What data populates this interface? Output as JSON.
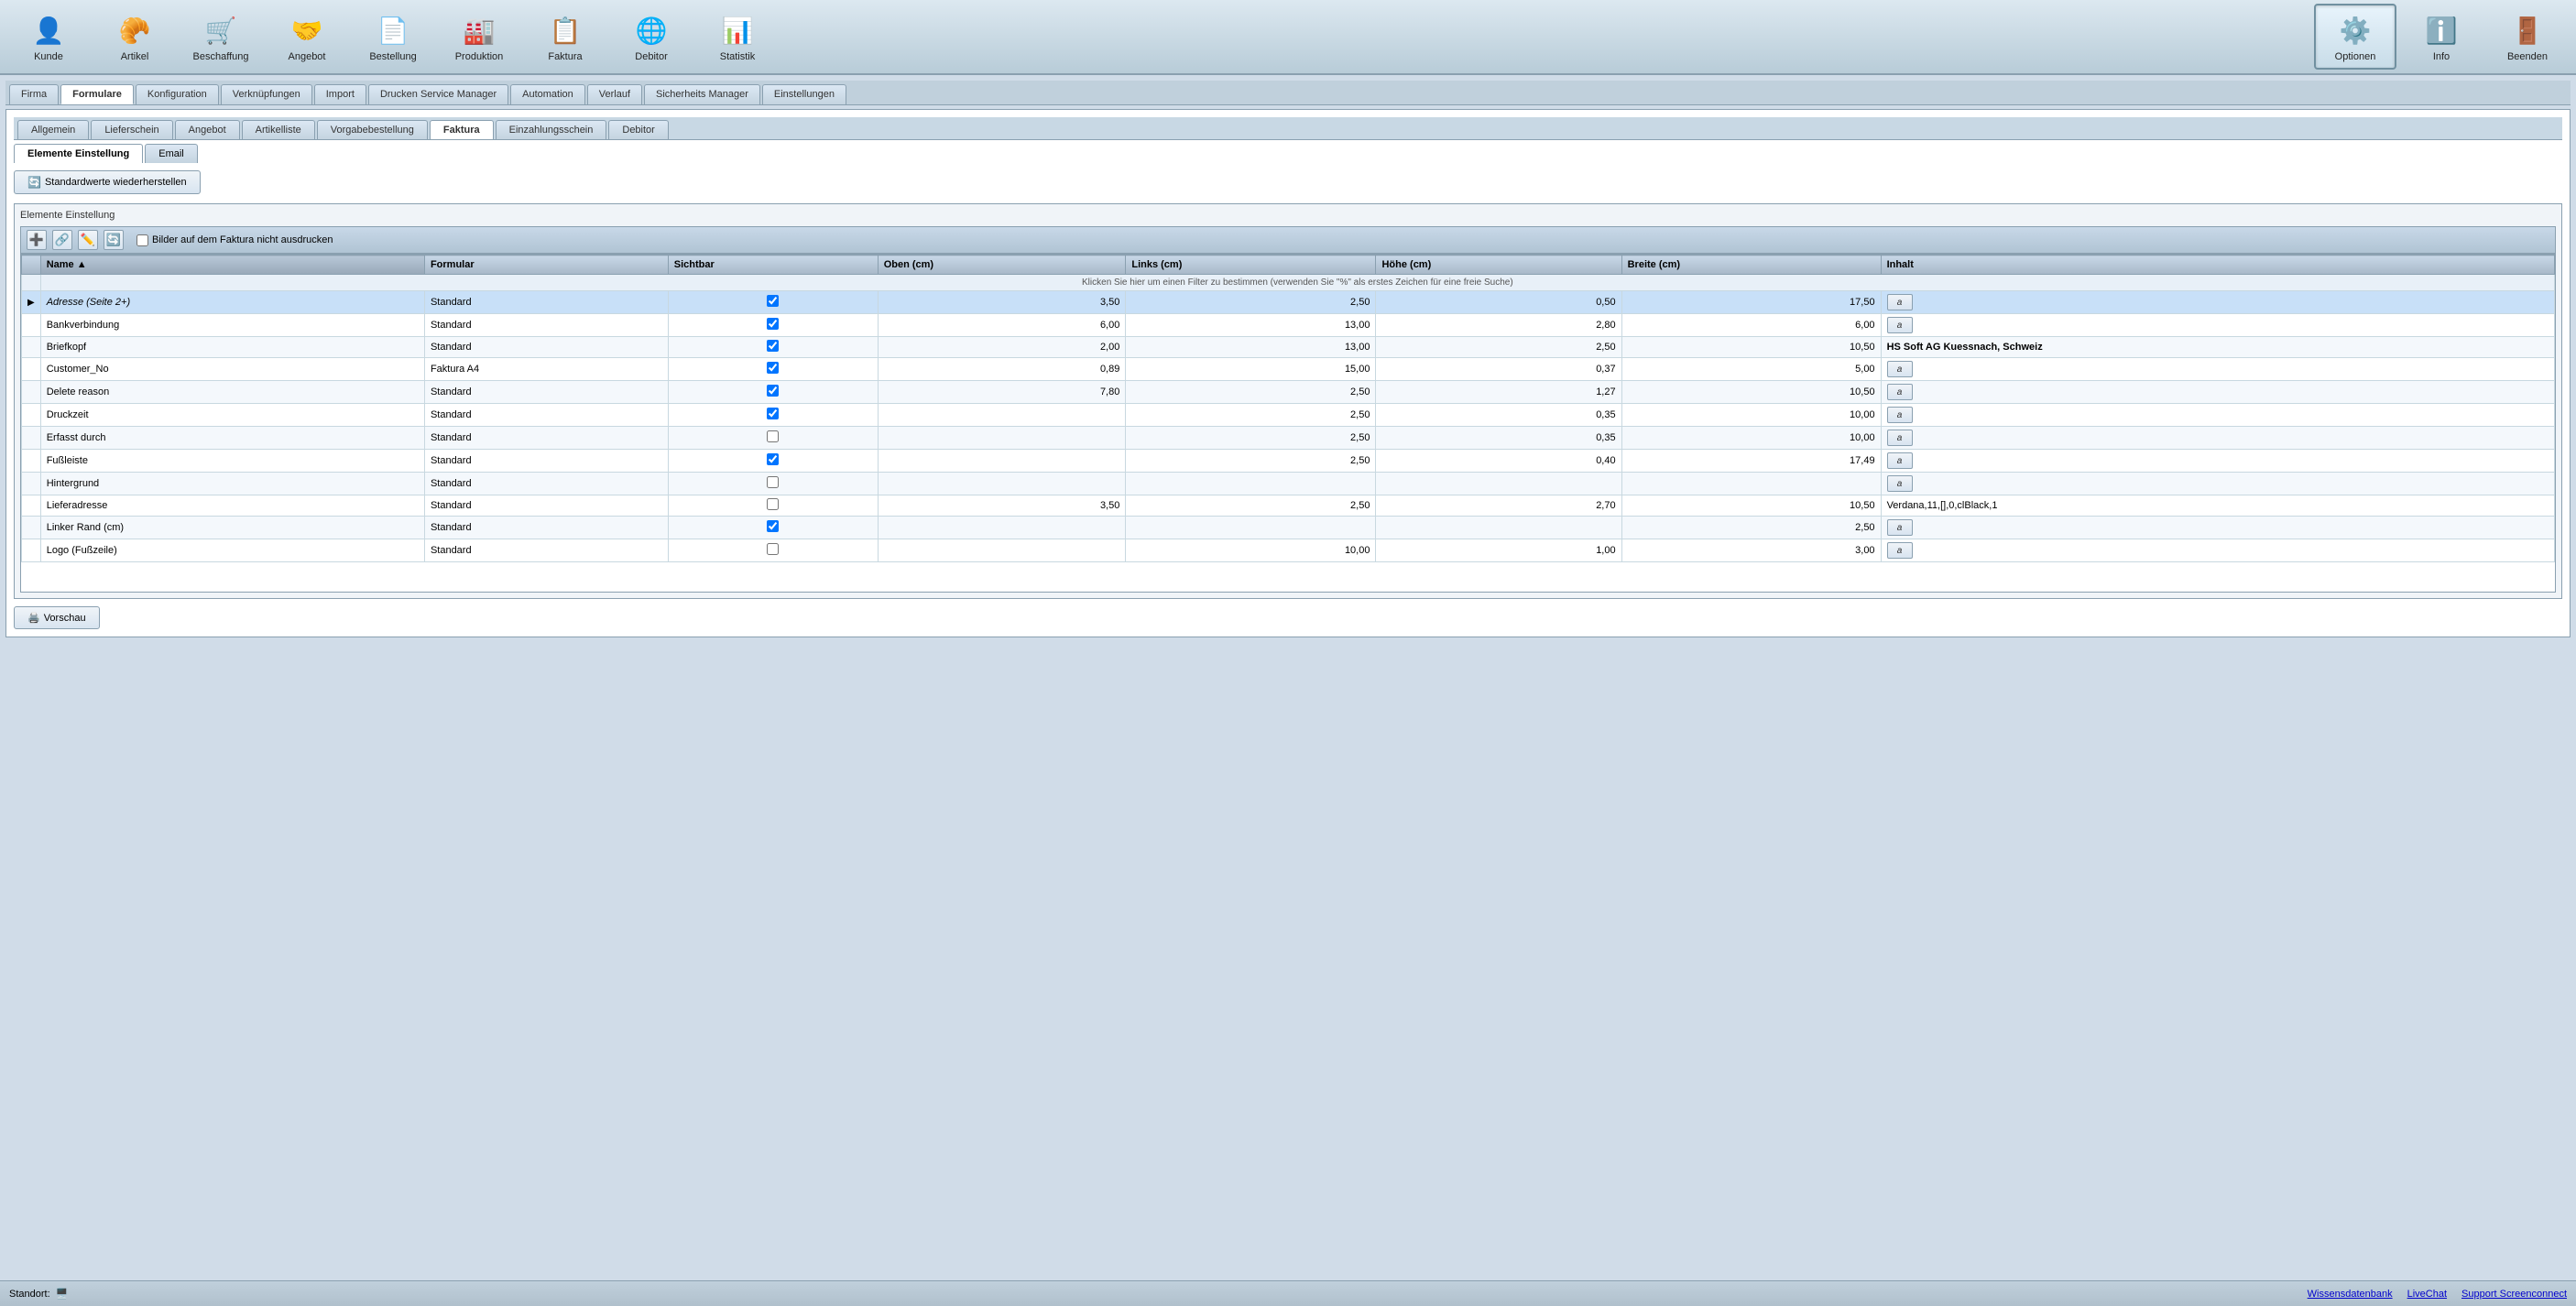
{
  "toolbar": {
    "items": [
      {
        "id": "kunde",
        "label": "Kunde",
        "icon": "👤"
      },
      {
        "id": "artikel",
        "label": "Artikel",
        "icon": "🥐"
      },
      {
        "id": "beschaffung",
        "label": "Beschaffung",
        "icon": "🛒"
      },
      {
        "id": "angebot",
        "label": "Angebot",
        "icon": "🤝"
      },
      {
        "id": "bestellung",
        "label": "Bestellung",
        "icon": "📄"
      },
      {
        "id": "produktion",
        "label": "Produktion",
        "icon": "🏭"
      },
      {
        "id": "faktura",
        "label": "Faktura",
        "icon": "📋"
      },
      {
        "id": "debitor",
        "label": "Debitor",
        "icon": "🌐"
      },
      {
        "id": "statistik",
        "label": "Statistik",
        "icon": "📊"
      }
    ],
    "right_items": [
      {
        "id": "optionen",
        "label": "Optionen",
        "icon": "⚙️",
        "active": true
      },
      {
        "id": "info",
        "label": "Info",
        "icon": "ℹ️"
      },
      {
        "id": "beenden",
        "label": "Beenden",
        "icon": "🚪"
      }
    ]
  },
  "main_tabs": [
    {
      "id": "firma",
      "label": "Firma"
    },
    {
      "id": "formulare",
      "label": "Formulare",
      "active": true
    },
    {
      "id": "konfiguration",
      "label": "Konfiguration"
    },
    {
      "id": "verknupfungen",
      "label": "Verknüpfungen"
    },
    {
      "id": "import",
      "label": "Import"
    },
    {
      "id": "drucken_service",
      "label": "Drucken Service Manager"
    },
    {
      "id": "automation",
      "label": "Automation"
    },
    {
      "id": "verlauf",
      "label": "Verlauf"
    },
    {
      "id": "sicherheits",
      "label": "Sicherheits Manager"
    },
    {
      "id": "einstellungen",
      "label": "Einstellungen"
    }
  ],
  "sub_tabs": [
    {
      "id": "allgemein",
      "label": "Allgemein"
    },
    {
      "id": "lieferschein",
      "label": "Lieferschein"
    },
    {
      "id": "angebot",
      "label": "Angebot"
    },
    {
      "id": "artikelliste",
      "label": "Artikelliste"
    },
    {
      "id": "vorgabebestellung",
      "label": "Vorgabebestellung"
    },
    {
      "id": "faktura",
      "label": "Faktura",
      "active": true
    },
    {
      "id": "einzahlungsschein",
      "label": "Einzahlungsschein"
    },
    {
      "id": "debitor",
      "label": "Debitor"
    }
  ],
  "ee_tabs": [
    {
      "id": "elemente_einstellung",
      "label": "Elemente Einstellung",
      "active": true
    },
    {
      "id": "email",
      "label": "Email"
    }
  ],
  "restore_btn": "Standardwerte wiederherstellen",
  "elemente_label": "Elemente Einstellung",
  "bilder_check_label": "Bilder auf dem Faktura nicht ausdrucken",
  "toolbar_mini": {
    "icons": [
      "➕",
      "🔗",
      "✏️",
      "🔄"
    ]
  },
  "table": {
    "columns": [
      {
        "id": "name",
        "label": "Name",
        "sorted": true
      },
      {
        "id": "formular",
        "label": "Formular"
      },
      {
        "id": "sichtbar",
        "label": "Sichtbar"
      },
      {
        "id": "oben",
        "label": "Oben (cm)"
      },
      {
        "id": "links",
        "label": "Links (cm)"
      },
      {
        "id": "hohe",
        "label": "Höhe (cm)"
      },
      {
        "id": "breite",
        "label": "Breite (cm)"
      },
      {
        "id": "inhalt",
        "label": "Inhalt"
      }
    ],
    "filter_hint": "Klicken Sie hier um einen Filter zu bestimmen (verwenden Sie \"%\" als erstes Zeichen für eine freie Suche)",
    "rows": [
      {
        "selected": true,
        "indicator": "▶",
        "name": "Adresse (Seite 2+)",
        "formular": "Standard",
        "sichtbar": "✓",
        "oben": "3,50",
        "links": "2,50",
        "hohe": "0,50",
        "breite": "17,50",
        "inhalt_type": "btn",
        "inhalt": "a"
      },
      {
        "selected": false,
        "indicator": "",
        "name": "Bankverbindung",
        "formular": "Standard",
        "sichtbar": "☑",
        "oben": "6,00",
        "links": "13,00",
        "hohe": "2,80",
        "breite": "6,00",
        "inhalt_type": "btn",
        "inhalt": "a"
      },
      {
        "selected": false,
        "indicator": "",
        "name": "Briefkopf",
        "formular": "Standard",
        "sichtbar": "☑",
        "oben": "2,00",
        "links": "13,00",
        "hohe": "2,50",
        "breite": "10,50",
        "inhalt_type": "bold",
        "inhalt": "HS Soft AG Kuessnach, Schweiz"
      },
      {
        "selected": false,
        "indicator": "",
        "name": "Customer_No",
        "formular": "Faktura A4",
        "sichtbar": "☑",
        "oben": "0,89",
        "links": "15,00",
        "hohe": "0,37",
        "breite": "5,00",
        "inhalt_type": "btn",
        "inhalt": "a"
      },
      {
        "selected": false,
        "indicator": "",
        "name": "Delete reason",
        "formular": "Standard",
        "sichtbar": "☑",
        "oben": "7,80",
        "links": "2,50",
        "hohe": "1,27",
        "breite": "10,50",
        "inhalt_type": "btn",
        "inhalt": "a"
      },
      {
        "selected": false,
        "indicator": "",
        "name": "Druckzeit",
        "formular": "Standard",
        "sichtbar": "☑",
        "oben": "",
        "links": "2,50",
        "hohe": "0,35",
        "breite": "10,00",
        "inhalt_type": "btn",
        "inhalt": "a"
      },
      {
        "selected": false,
        "indicator": "",
        "name": "Erfasst durch",
        "formular": "Standard",
        "sichtbar": "☐",
        "oben": "",
        "links": "2,50",
        "hohe": "0,35",
        "breite": "10,00",
        "inhalt_type": "btn",
        "inhalt": "a"
      },
      {
        "selected": false,
        "indicator": "",
        "name": "Fußleiste",
        "formular": "Standard",
        "sichtbar": "☑",
        "oben": "",
        "links": "2,50",
        "hohe": "0,40",
        "breite": "17,49",
        "inhalt_type": "btn",
        "inhalt": "a"
      },
      {
        "selected": false,
        "indicator": "",
        "name": "Hintergrund",
        "formular": "Standard",
        "sichtbar": "☐",
        "oben": "",
        "links": "",
        "hohe": "",
        "breite": "",
        "inhalt_type": "btn",
        "inhalt": "a"
      },
      {
        "selected": false,
        "indicator": "",
        "name": "Lieferadresse",
        "formular": "Standard",
        "sichtbar": "☐",
        "oben": "3,50",
        "links": "2,50",
        "hohe": "2,70",
        "breite": "10,50",
        "inhalt_type": "text",
        "inhalt": "Verdana,11,[],0,clBlack,1"
      },
      {
        "selected": false,
        "indicator": "",
        "name": "Linker Rand (cm)",
        "formular": "Standard",
        "sichtbar": "☑",
        "oben": "",
        "links": "",
        "hohe": "",
        "breite": "2,50",
        "inhalt_type": "btn",
        "inhalt": "a"
      },
      {
        "selected": false,
        "indicator": "",
        "name": "Logo (Fußzeile)",
        "formular": "Standard",
        "sichtbar": "☐",
        "oben": "",
        "links": "10,00",
        "hohe": "1,00",
        "breite": "3,00",
        "inhalt_type": "btn",
        "inhalt": "a"
      }
    ]
  },
  "vorschau_btn": "Vorschau",
  "status": {
    "left": "Standort:",
    "right_links": [
      "Wissensdatenbank",
      "LiveChat",
      "Support Screenconnect"
    ]
  }
}
